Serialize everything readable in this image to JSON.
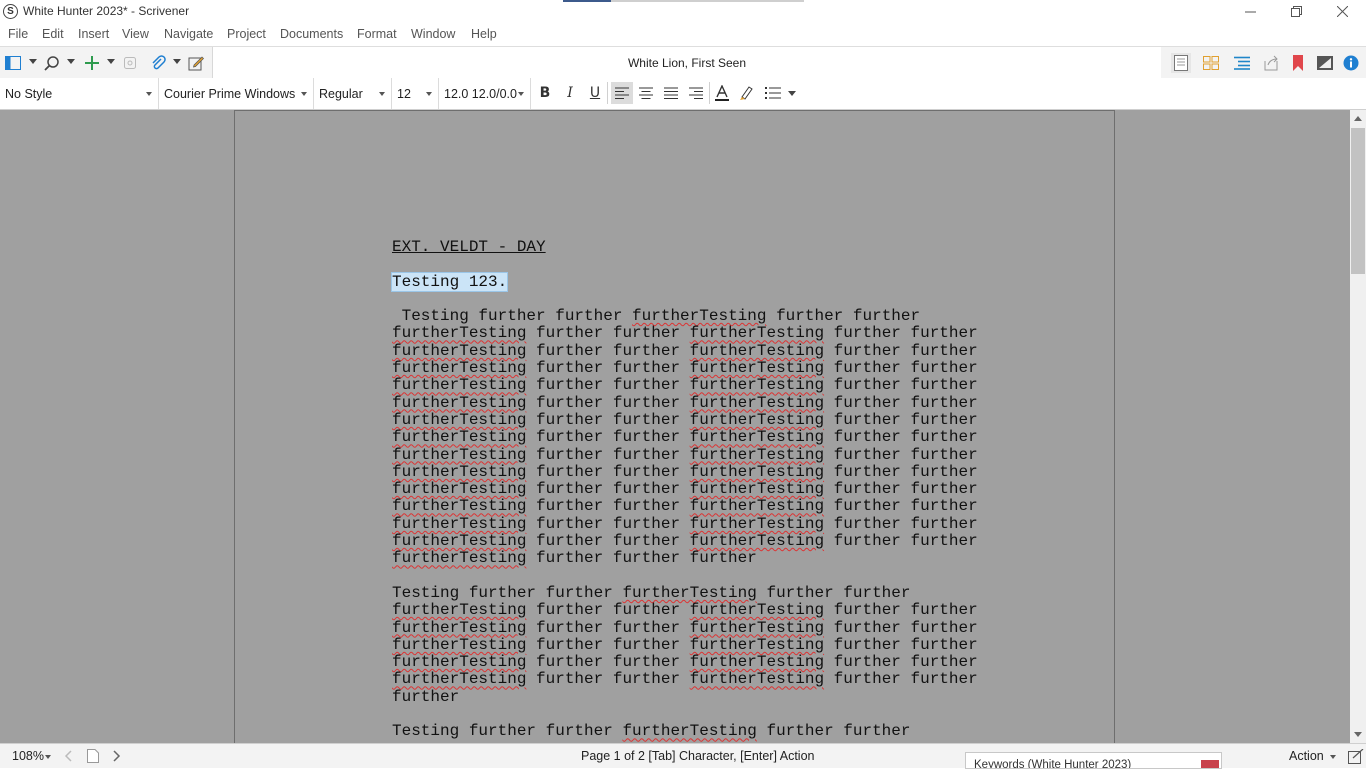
{
  "window": {
    "title": "White Hunter 2023* - Scrivener",
    "logo_letter": "S",
    "controls": [
      "minimize",
      "restore",
      "close"
    ]
  },
  "menu": [
    "File",
    "Edit",
    "Insert",
    "View",
    "Navigate",
    "Project",
    "Documents",
    "Format",
    "Window",
    "Help"
  ],
  "toolbar": {
    "document_title": "White Lion, First Seen",
    "left_icons": [
      "binder-icon",
      "search-icon",
      "add-icon",
      "trash-icon",
      "attachment-icon",
      "compose-icon"
    ],
    "right_icons": [
      "single-page-view-icon",
      "corkboard-icon",
      "outliner-icon",
      "share-icon",
      "bookmark-icon",
      "inspector-toggle-icon",
      "info-icon"
    ],
    "colors": {
      "add": "#2e9b4e",
      "bookmark": "#e0464b",
      "info": "#1f7fd1",
      "corkboard": "#e0a030",
      "outliner": "#1f86c9"
    }
  },
  "format": {
    "style": "No Style",
    "font": "Courier Prime Windows",
    "weight": "Regular",
    "size": "12",
    "spacing": "12.0 12.0/0.0",
    "buttons": [
      "bold",
      "italic",
      "underline",
      "align-left",
      "align-center",
      "align-justify",
      "align-right",
      "text-color",
      "highlight",
      "list"
    ],
    "active_alignment": "align-left"
  },
  "editor": {
    "scene_heading": "EXT. VELDT - DAY",
    "selected_line": "Testing 123.",
    "paragraphs": [
      [
        " Testing further further furtherTesting further further",
        "furtherTesting further further furtherTesting further further",
        "furtherTesting further further furtherTesting further further",
        "furtherTesting further further furtherTesting further further",
        "furtherTesting further further furtherTesting further further",
        "furtherTesting further further furtherTesting further further",
        "furtherTesting further further furtherTesting further further",
        "furtherTesting further further furtherTesting further further",
        "furtherTesting further further furtherTesting further further",
        "furtherTesting further further furtherTesting further further",
        "furtherTesting further further furtherTesting further further",
        "furtherTesting further further furtherTesting further further",
        "furtherTesting further further furtherTesting further further",
        "furtherTesting further further furtherTesting further further",
        "furtherTesting further further further"
      ],
      [
        "Testing further further furtherTesting further further",
        "furtherTesting further further furtherTesting further further",
        "furtherTesting further further furtherTesting further further",
        "furtherTesting further further furtherTesting further further",
        "furtherTesting further further furtherTesting further further",
        "furtherTesting further further furtherTesting further further",
        "further"
      ],
      [
        "Testing further further furtherTesting further further"
      ]
    ],
    "misspelled_word": "furtherTesting"
  },
  "status": {
    "zoom": "108%",
    "page_info": "Page 1 of 2   [Tab] Character, [Enter] Action",
    "keywords_title": "Keywords (White Hunter 2023)",
    "keywords_color": "#c8424c",
    "action_label": "Action"
  }
}
